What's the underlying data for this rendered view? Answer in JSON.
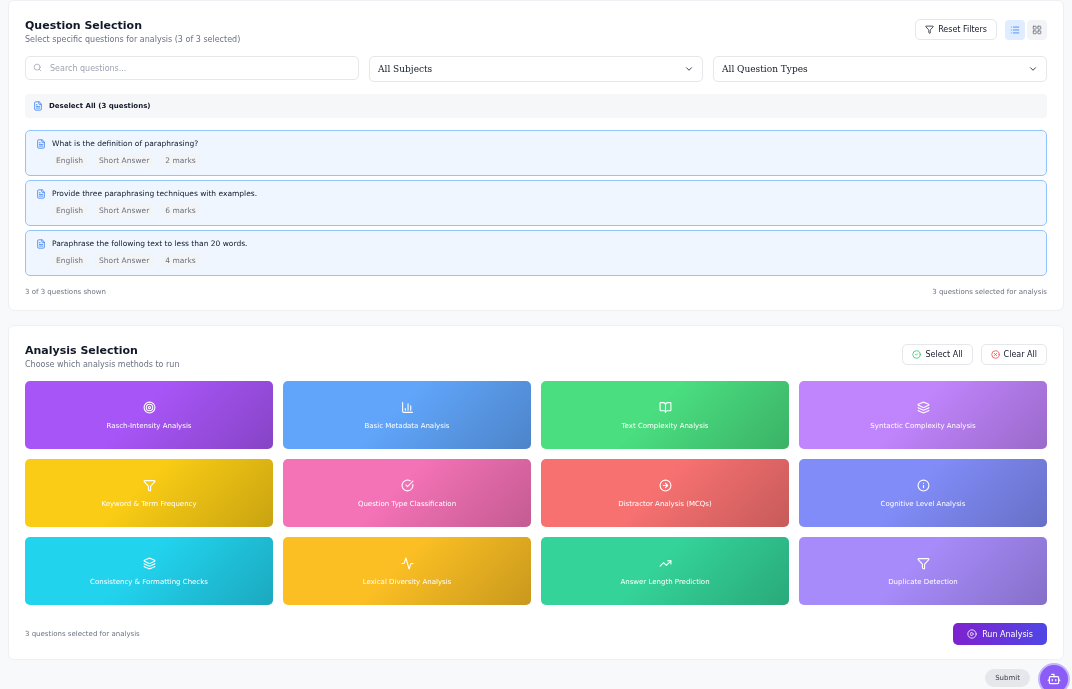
{
  "question_selection": {
    "title": "Question Selection",
    "subtitle": "Select specific questions for analysis (3 of 3 selected)",
    "reset_button": "Reset Filters",
    "view_toggle": [
      {
        "kind": "list",
        "selected": true
      },
      {
        "kind": "grid",
        "selected": false
      }
    ],
    "search": {
      "placeholder": "Search questions..."
    },
    "subject_filter": "All Subjects",
    "type_filter": "All Question Types",
    "deselect_all": "Deselect All (3 questions)",
    "questions": [
      {
        "text": "What is the definition of paraphrasing?",
        "tags": [
          "English",
          "Short Answer",
          "2 marks"
        ],
        "selected": true
      },
      {
        "text": "Provide three paraphrasing techniques with examples.",
        "tags": [
          "English",
          "Short Answer",
          "6 marks"
        ],
        "selected": true
      },
      {
        "text": "Paraphrase the following text to less than 20 words.",
        "tags": [
          "English",
          "Short Answer",
          "4 marks"
        ],
        "selected": true
      }
    ],
    "shown_count": "3 of 3 questions shown",
    "selected_count": "3 questions selected for analysis"
  },
  "analysis_selection": {
    "title": "Analysis Selection",
    "subtitle": "Choose which analysis methods to run",
    "select_all": "Select All",
    "clear_all": "Clear All",
    "methods": [
      {
        "label": "Rasch-Intensity Analysis",
        "color": "#a855f7"
      },
      {
        "label": "Basic Metadata Analysis",
        "color": "#60a5fa"
      },
      {
        "label": "Text Complexity Analysis",
        "color": "#4ade80"
      },
      {
        "label": "Syntactic Complexity Analysis",
        "color": "#c084fc"
      },
      {
        "label": "Keyword & Term Frequency",
        "color": "#facc15"
      },
      {
        "label": "Question Type Classification",
        "color": "#f472b6"
      },
      {
        "label": "Distractor Analysis (MCQs)",
        "color": "#f87171"
      },
      {
        "label": "Cognitive Level Analysis",
        "color": "#818cf8"
      },
      {
        "label": "Consistency & Formatting Checks",
        "color": "#22d3ee"
      },
      {
        "label": "Lexical Diversity Analysis",
        "color": "#fbbf24"
      },
      {
        "label": "Answer Length Prediction",
        "color": "#34d399"
      },
      {
        "label": "Duplicate Detection",
        "color": "#a78bfa"
      }
    ],
    "footer_note": "3 questions selected for analysis",
    "run_button": "Run Analysis"
  },
  "submit_chip": "Submit"
}
